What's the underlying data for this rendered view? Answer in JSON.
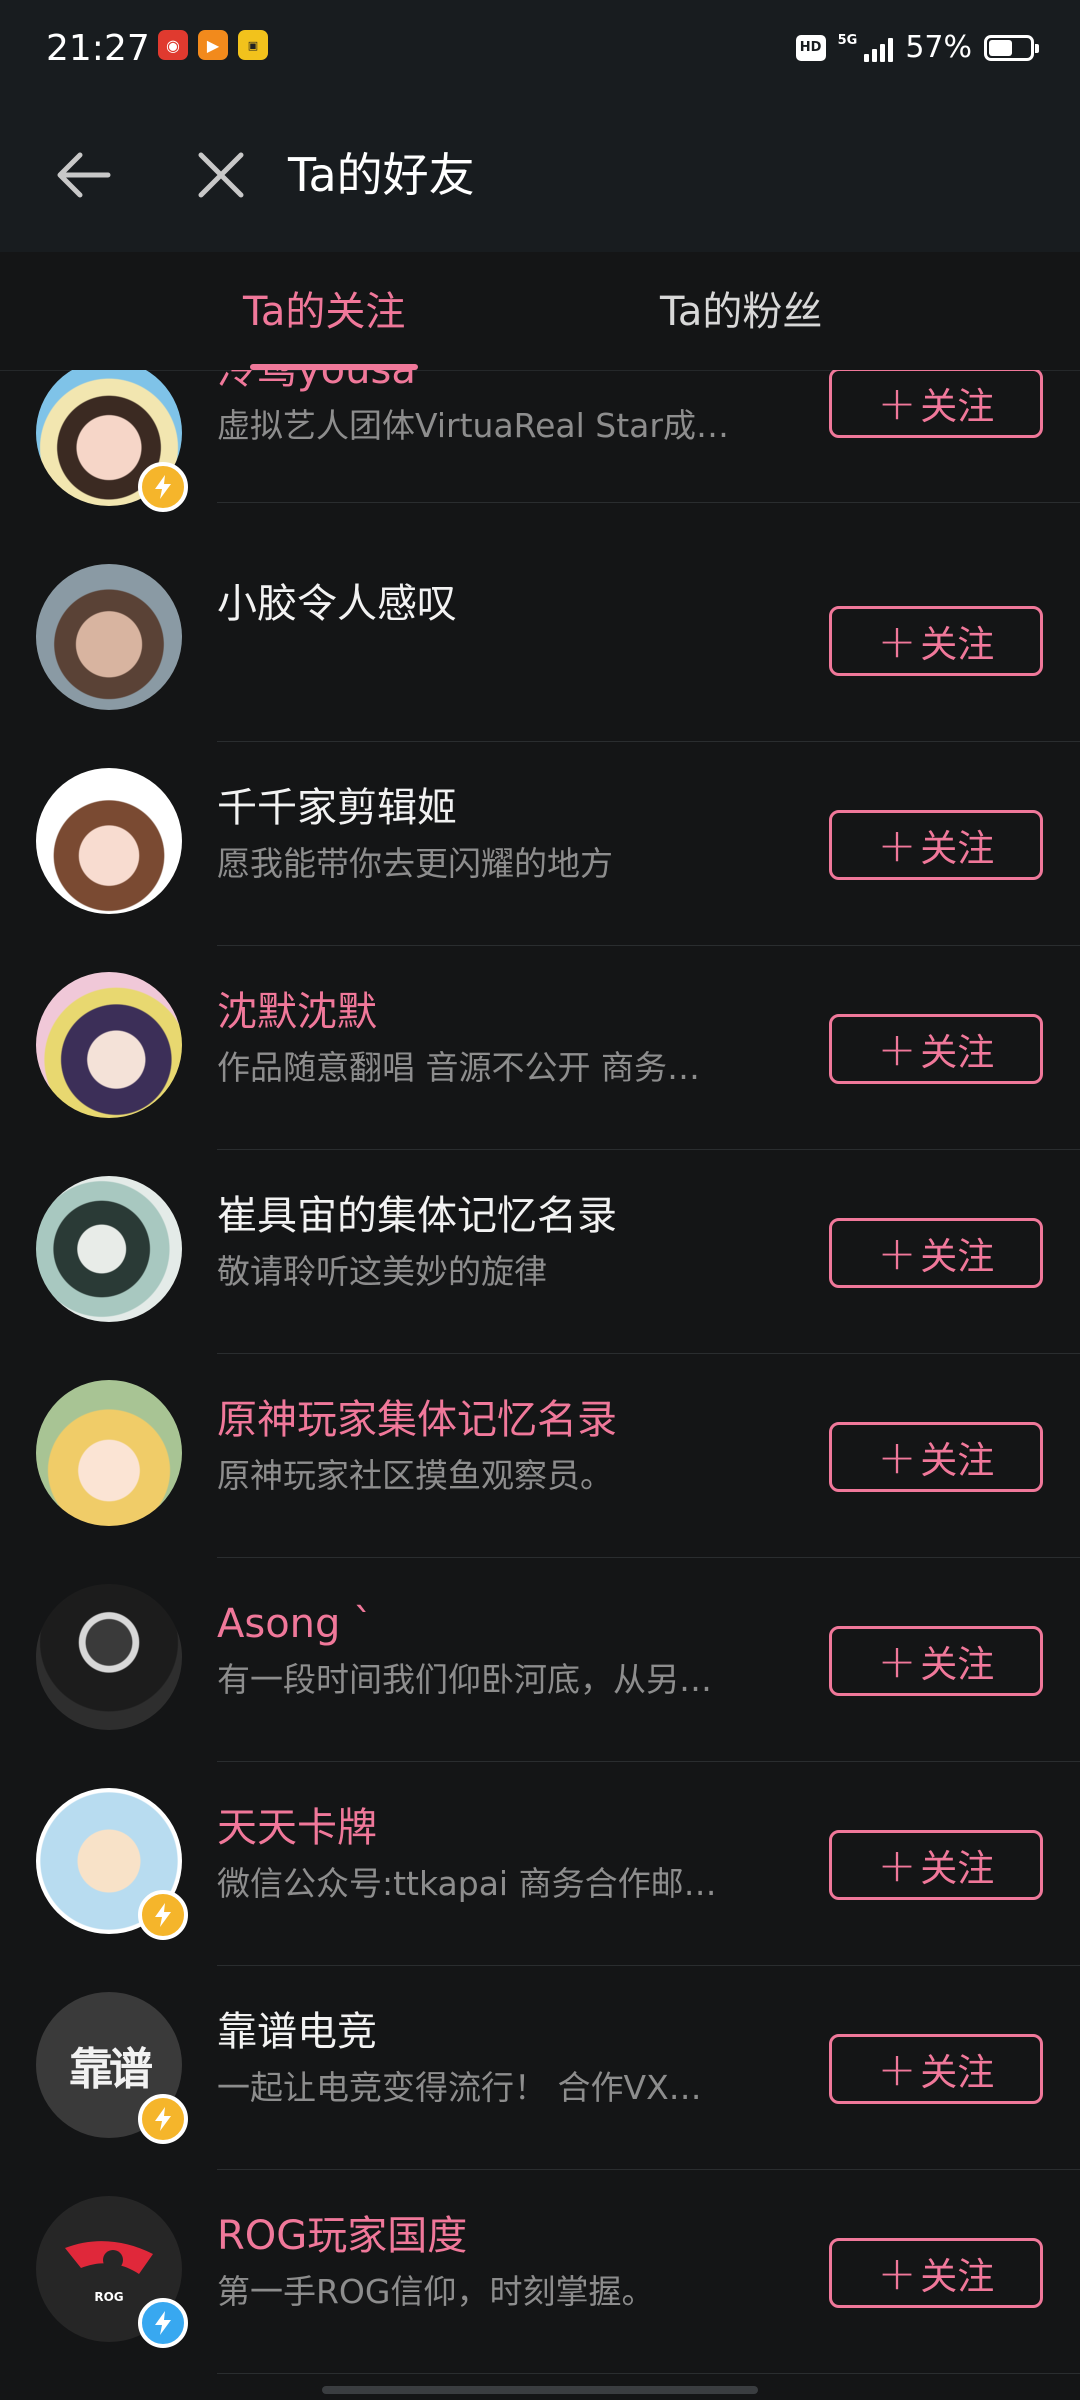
{
  "status": {
    "time": "21:27",
    "hd": "HD",
    "network": "5G",
    "battery_pct": "57%",
    "battery_level": 0.57
  },
  "nav": {
    "title": "Ta的好友",
    "back_icon": "arrow-left-icon",
    "close_icon": "close-icon"
  },
  "tabs": [
    {
      "label": "Ta的关注",
      "active": true
    },
    {
      "label": "Ta的粉丝",
      "active": false
    }
  ],
  "colors": {
    "accent": "#f0789a",
    "background": "#141516",
    "header": "#181c1f",
    "verified_gold": "#f5b52b",
    "verified_blue": "#38a8f0"
  },
  "follow_label": "关注",
  "users": [
    {
      "name": "泠鸢yousa",
      "desc": "虚拟艺人团体VirtuaReal Star成…",
      "name_color": "pink",
      "verified": "gold"
    },
    {
      "name": "小胶令人感叹",
      "desc": "",
      "name_color": "white",
      "verified": ""
    },
    {
      "name": "千千家剪辑姬",
      "desc": "愿我能带你去更闪耀的地方",
      "name_color": "white",
      "verified": ""
    },
    {
      "name": "沈默沈默",
      "desc": "作品随意翻唱 音源不公开 商务…",
      "name_color": "pink",
      "verified": ""
    },
    {
      "name": "崔具宙的集体记忆名录",
      "desc": "敬请聆听这美妙的旋律",
      "name_color": "white",
      "verified": ""
    },
    {
      "name": "原神玩家集体记忆名录",
      "desc": "原神玩家社区摸鱼观察员。",
      "name_color": "pink",
      "verified": ""
    },
    {
      "name": "Asong ˋ",
      "desc": "有一段时间我们仰卧河底，从另…",
      "name_color": "pink",
      "verified": ""
    },
    {
      "name": "天天卡牌",
      "desc": "微信公众号:ttkapai 商务合作邮…",
      "name_color": "pink",
      "verified": "gold"
    },
    {
      "name": "靠谱电竞",
      "desc": "一起让电竞变得流行！ 合作VX…",
      "name_color": "white",
      "verified": "gold"
    },
    {
      "name": "ROG玩家国度",
      "desc": "第一手ROG信仰，时刻掌握。",
      "name_color": "pink",
      "verified": "blue"
    }
  ]
}
